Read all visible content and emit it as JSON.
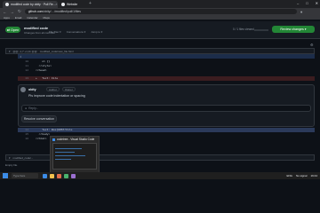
{
  "browser": {
    "tabs": [
      {
        "label": "modified code by obity · Pull Re...",
        "active": true
      },
      {
        "label": "Website",
        "active": false
      }
    ],
    "new_tab_symbol": "+",
    "window_controls": [
      "–",
      "□",
      "✕"
    ],
    "url_host": "github.com",
    "url_path": "/obity/..../modified/pull/1/files",
    "bookmarks": [
      "Apps",
      "Email",
      "Calendar",
      "Maps"
    ]
  },
  "pr": {
    "state": "Open",
    "title": "modified code",
    "subtitle": "Changes from all commits",
    "filters": [
      "File filter ▾",
      "Conversations ▾",
      "Jump to ▾"
    ],
    "viewed": "0 / 1 files viewed",
    "review_button": "Review changes ▾",
    "file_name": "modified_code/new_file.html",
    "file_lines": "@@ -1,7 +1,11 @@"
  },
  "diff_lines": [
    {
      "num": "10",
      "text": "    ul {}",
      "kind": "ctx"
    },
    {
      "num": "11",
      "text": "  </style>",
      "kind": "ctx"
    },
    {
      "num": "12",
      "text": "</head>",
      "kind": "ctx"
    },
    {
      "num": "13",
      "text": "+   Text: File",
      "kind": "add"
    }
  ],
  "comment": {
    "user": "obity",
    "badges": [
      "Author",
      "Owner"
    ],
    "body": "Pls improve code indentation or spacing",
    "reply_placeholder": "Reply...",
    "resolve_label": "Resolve conversation"
  },
  "diff_lines_after": [
    {
      "num": "14",
      "text": "    Text: Box{HOST/File",
      "kind": "sel"
    },
    {
      "num": "15",
      "text": "  </body>",
      "kind": "ctx"
    },
    {
      "num": "16",
      "text": "</html>",
      "kind": "ctx"
    }
  ],
  "second_file": {
    "name": "modified_code/...",
    "empty_note": "Empty file."
  },
  "taskbar": {
    "search_placeholder": "Type here",
    "preview_title": "codetree - Visual Studio Code",
    "tray": [
      "ENG",
      "No signal",
      "19:44"
    ],
    "app_colors": [
      "#3c8ce7",
      "#f2c14e",
      "#e06c4a",
      "#4ab36e",
      "#9b6fd0"
    ]
  }
}
